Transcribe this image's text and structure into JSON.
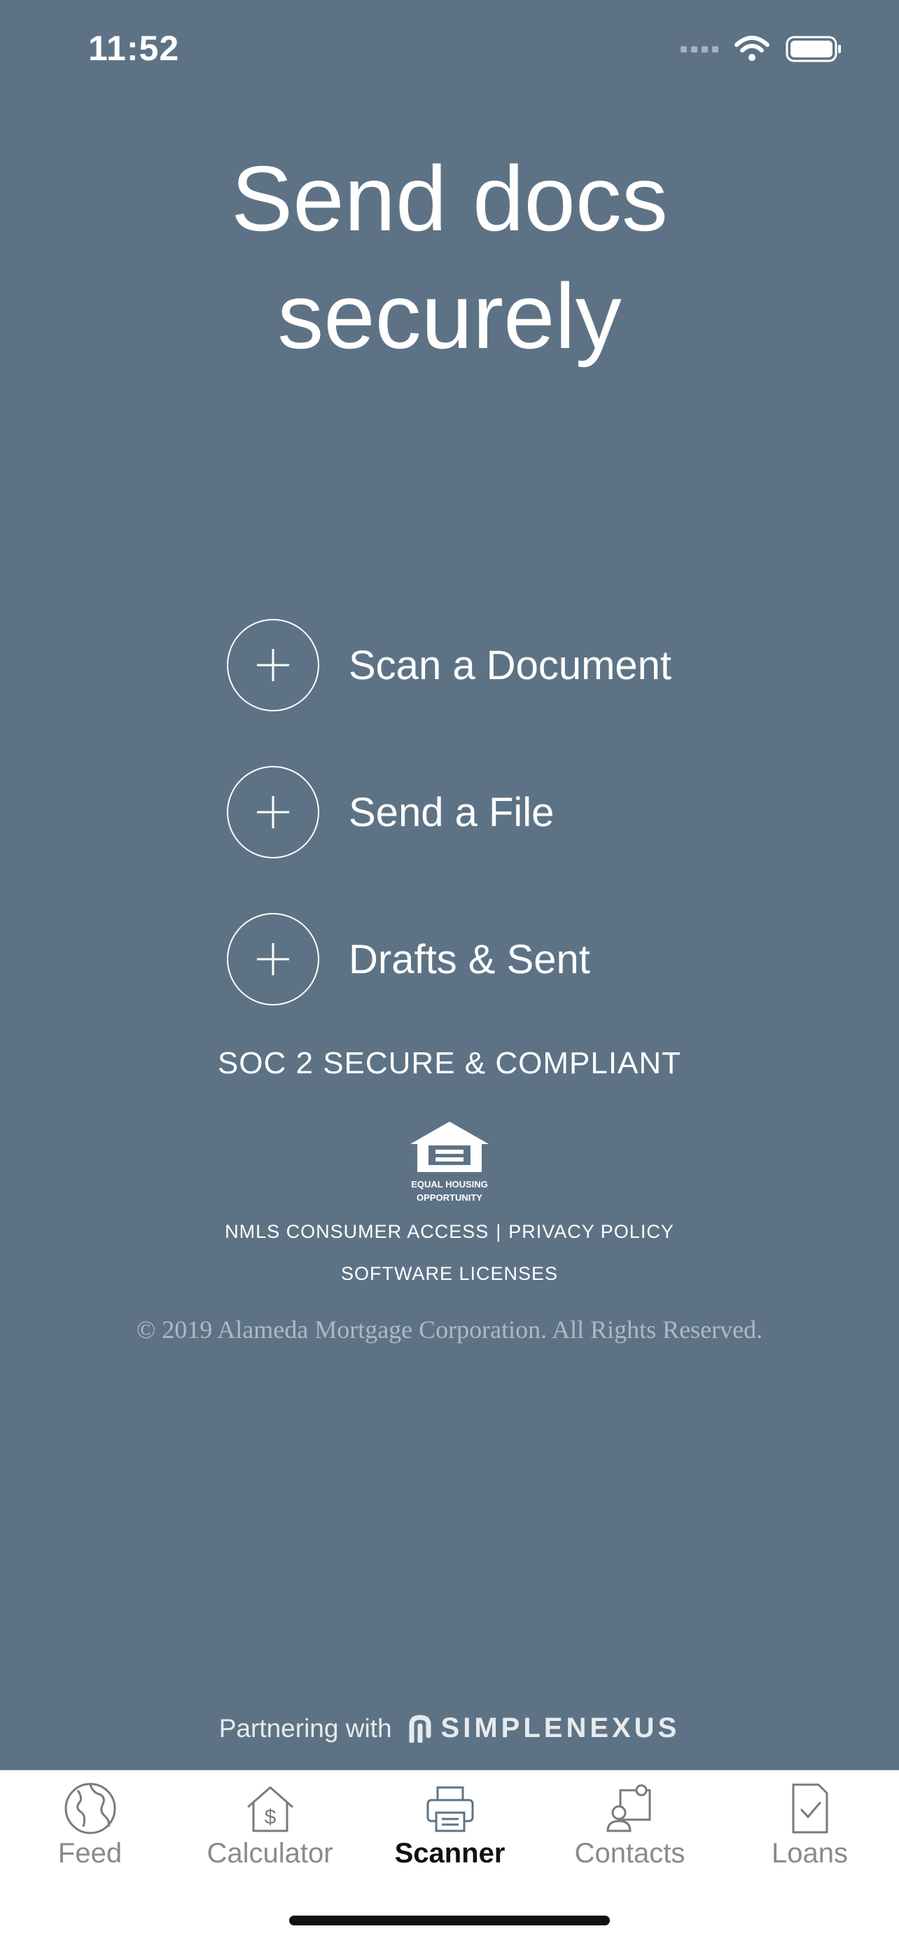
{
  "status_bar": {
    "time": "11:52",
    "icons": [
      "cellular-signal-icon",
      "wifi-icon",
      "battery-icon"
    ]
  },
  "title": "Send docs securely",
  "actions": [
    {
      "label": "Scan a Document",
      "icon": "plus-icon"
    },
    {
      "label": "Send a File",
      "icon": "plus-icon"
    },
    {
      "label": "Drafts & Sent",
      "icon": "plus-icon"
    }
  ],
  "soc_badge": "SOC 2 SECURE & COMPLIANT",
  "equal_housing": {
    "icon": "equal-housing-house-icon",
    "line1": "EQUAL HOUSING",
    "line2": "OPPORTUNITY"
  },
  "footer_links": {
    "nmls": "NMLS CONSUMER ACCESS",
    "separator": "|",
    "privacy": "PRIVACY POLICY",
    "licenses": "SOFTWARE LICENSES"
  },
  "copyright": "© 2019 Alameda Mortgage Corporation. All Rights Reserved.",
  "partner": {
    "text": "Partnering with",
    "brand": "SIMPLENEXUS",
    "icon": "simplenexus-logo-icon"
  },
  "tabs": [
    {
      "label": "Feed",
      "icon": "globe-icon",
      "active": false
    },
    {
      "label": "Calculator",
      "icon": "house-dollar-icon",
      "active": false
    },
    {
      "label": "Scanner",
      "icon": "printer-icon",
      "active": true
    },
    {
      "label": "Contacts",
      "icon": "contacts-icon",
      "active": false
    },
    {
      "label": "Loans",
      "icon": "document-check-icon",
      "active": false
    }
  ],
  "colors": {
    "background": "#5d7385",
    "tab_bar": "#ffffff",
    "tab_inactive": "#8a8a8a",
    "tab_active": "#111111"
  }
}
